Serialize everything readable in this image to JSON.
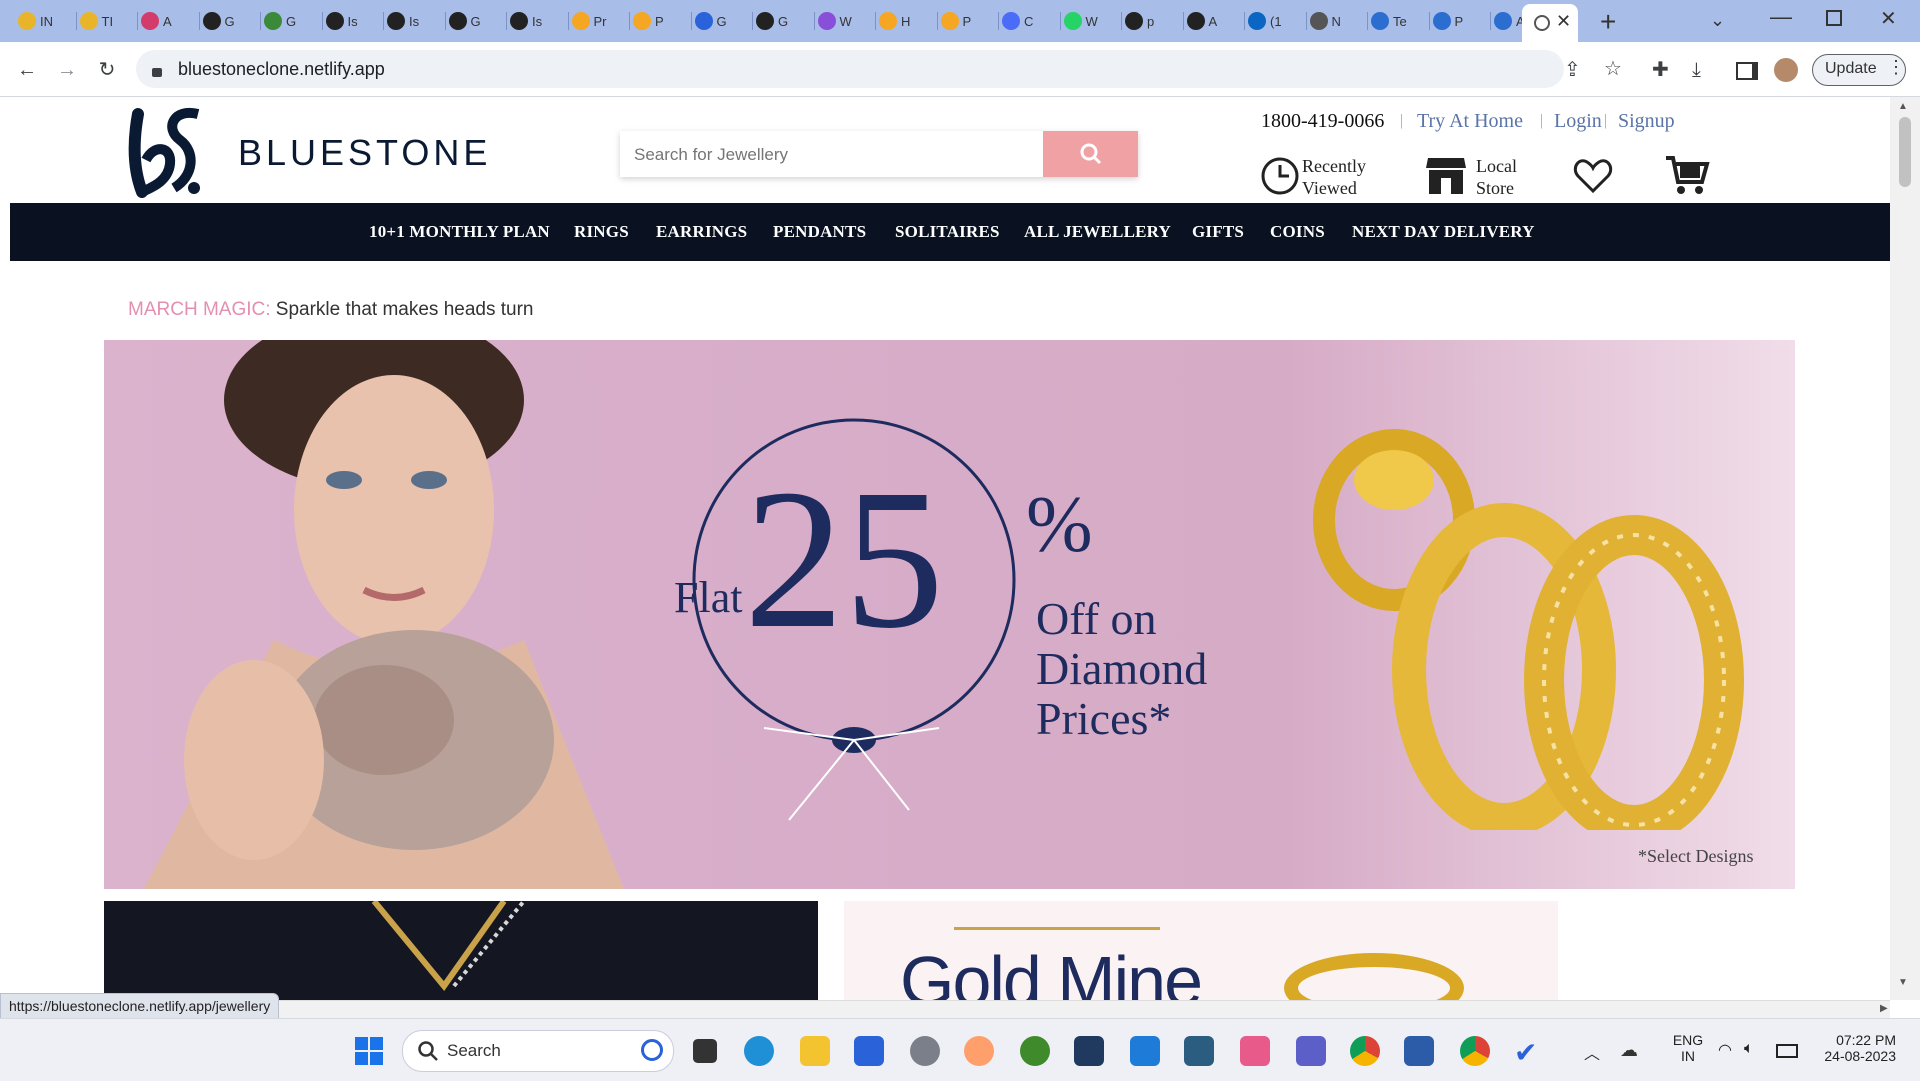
{
  "browser": {
    "tabs": [
      {
        "label": "IN",
        "color": "#e8b52a"
      },
      {
        "label": "TI",
        "color": "#e8b52a"
      },
      {
        "label": "A",
        "color": "#d33c6a"
      },
      {
        "label": "G",
        "color": "#222"
      },
      {
        "label": "G",
        "color": "#3a8a3a"
      },
      {
        "label": "Is",
        "color": "#222"
      },
      {
        "label": "Is",
        "color": "#222"
      },
      {
        "label": "G",
        "color": "#222"
      },
      {
        "label": "Is",
        "color": "#222"
      },
      {
        "label": "Pr",
        "color": "#f5a623"
      },
      {
        "label": "P",
        "color": "#f5a623"
      },
      {
        "label": "G",
        "color": "#2a62d9"
      },
      {
        "label": "G",
        "color": "#222"
      },
      {
        "label": "W",
        "color": "#8a4fd8"
      },
      {
        "label": "H",
        "color": "#f5a623"
      },
      {
        "label": "P",
        "color": "#f5a623"
      },
      {
        "label": "C",
        "color": "#4a6cf7"
      },
      {
        "label": "W",
        "color": "#25d366"
      },
      {
        "label": "p",
        "color": "#222"
      },
      {
        "label": "A",
        "color": "#222"
      },
      {
        "label": "(1",
        "color": "#0a66c2"
      },
      {
        "label": "N",
        "color": "#555"
      },
      {
        "label": "Te",
        "color": "#2b6ed0"
      },
      {
        "label": "P",
        "color": "#2b6ed0"
      },
      {
        "label": "A",
        "color": "#2b6ed0"
      }
    ],
    "url": "bluestoneclone.netlify.app",
    "update_label": "Update",
    "status_url": "https://bluestoneclone.netlify.app/jewellery"
  },
  "header": {
    "brand": "BLUESTONE",
    "search_placeholder": "Search for Jewellery",
    "phone": "1800-419-0066",
    "links": [
      "Try At Home",
      "Login",
      "Signup"
    ],
    "recently_viewed": [
      "Recently",
      "Viewed"
    ],
    "local_store": [
      "Local",
      "Store"
    ]
  },
  "nav": [
    "10+1 MONTHLY PLAN",
    "RINGS",
    "EARRINGS",
    "PENDANTS",
    "SOLITAIRES",
    "ALL JEWELLERY",
    "GIFTS",
    "COINS",
    "NEXT DAY DELIVERY"
  ],
  "promo": {
    "highlight": "MARCH MAGIC:",
    "text": "Sparkle that makes heads turn"
  },
  "banner": {
    "flat": "Flat",
    "number": "25",
    "percent": "%",
    "line1": "Off on",
    "line2": "Diamond",
    "line3": "Prices*",
    "note": "*Select Designs"
  },
  "secondary": {
    "gold_mine": "Gold Mine"
  },
  "taskbar": {
    "search_label": "Search",
    "lang1": "ENG",
    "lang2": "IN",
    "time": "07:22 PM",
    "date": "24-08-2023"
  },
  "colors": {
    "navbar": "#0a1120",
    "search_button": "#f0a1a4",
    "promo_highlight": "#e58fb0",
    "banner_text": "#1d2b5e"
  }
}
